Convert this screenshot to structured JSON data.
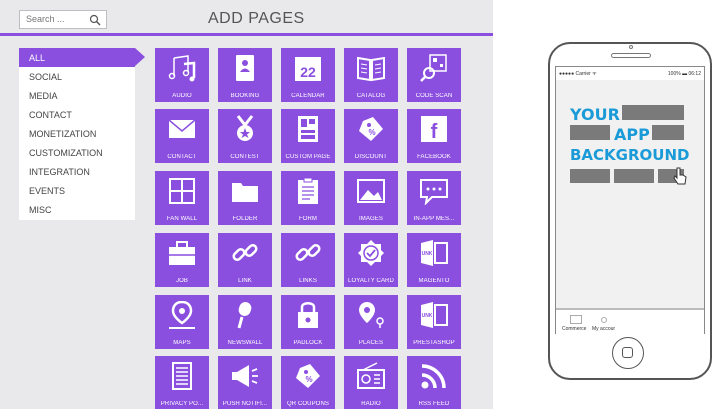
{
  "search": {
    "placeholder": "Search ..."
  },
  "page_title": "ADD PAGES",
  "categories": [
    "ALL",
    "SOCIAL",
    "MEDIA",
    "CONTACT",
    "MONETIZATION",
    "CUSTOMIZATION",
    "INTEGRATION",
    "EVENTS",
    "MISC"
  ],
  "active_category": "ALL",
  "tiles": [
    {
      "label": "AUDIO",
      "icon": "music-note-icon"
    },
    {
      "label": "BOOKING",
      "icon": "contact-card-icon"
    },
    {
      "label": "CALENDAR",
      "icon": "calendar-icon",
      "number": "22"
    },
    {
      "label": "CATALOG",
      "icon": "open-book-icon"
    },
    {
      "label": "CODE SCAN",
      "icon": "qr-scan-icon"
    },
    {
      "label": "CONTACT",
      "icon": "envelope-icon"
    },
    {
      "label": "CONTEST",
      "icon": "medal-icon"
    },
    {
      "label": "CUSTOM PAGE",
      "icon": "layout-icon"
    },
    {
      "label": "DISCOUNT",
      "icon": "discount-tag-icon"
    },
    {
      "label": "FACEBOOK",
      "icon": "facebook-icon"
    },
    {
      "label": "FAN WALL",
      "icon": "fan-wall-icon"
    },
    {
      "label": "FOLDER",
      "icon": "folder-icon"
    },
    {
      "label": "FORM",
      "icon": "clipboard-icon"
    },
    {
      "label": "IMAGES",
      "icon": "image-icon"
    },
    {
      "label": "IN-APP MES...",
      "icon": "chat-bubble-icon"
    },
    {
      "label": "JOB",
      "icon": "briefcase-icon"
    },
    {
      "label": "LINK",
      "icon": "chain-link-icon"
    },
    {
      "label": "LINKS",
      "icon": "chain-link-icon"
    },
    {
      "label": "LOYALTY CARD",
      "icon": "loyalty-badge-icon"
    },
    {
      "label": "MAGENTO",
      "icon": "magento-store-icon"
    },
    {
      "label": "MAPS",
      "icon": "map-pin-icon"
    },
    {
      "label": "NEWSWALL",
      "icon": "microphone-icon"
    },
    {
      "label": "PADLOCK",
      "icon": "padlock-icon"
    },
    {
      "label": "PLACES",
      "icon": "places-pin-icon"
    },
    {
      "label": "PRESTASHOP",
      "icon": "prestashop-store-icon"
    },
    {
      "label": "PRIVACY PO...",
      "icon": "document-icon"
    },
    {
      "label": "PUSH NOTIFI...",
      "icon": "megaphone-icon"
    },
    {
      "label": "QR COUPONS",
      "icon": "coupon-tag-icon"
    },
    {
      "label": "RADIO",
      "icon": "radio-icon"
    },
    {
      "label": "RSS FEED",
      "icon": "rss-icon"
    }
  ],
  "preview": {
    "carrier": "●●●●● Carrier ᯤ",
    "time": "100% ▬ 06:12",
    "line1": "YOUR",
    "line2": "APP",
    "line3": "BACKGROUND",
    "tabs": [
      "Commerce",
      "My accour"
    ]
  },
  "colors": {
    "accent": "#8b4fe0",
    "background_text": "#1a9bd7"
  }
}
